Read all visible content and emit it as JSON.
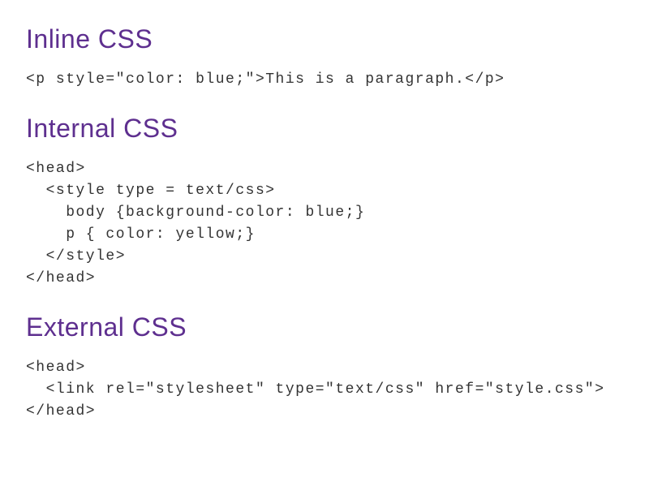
{
  "sections": [
    {
      "heading": "Inline CSS",
      "code": "<p style=\"color: blue;\">This is a paragraph.</p>"
    },
    {
      "heading": "Internal CSS",
      "code": "<head>\n  <style type = text/css>\n    body {background-color: blue;}\n    p { color: yellow;}\n  </style>\n</head>"
    },
    {
      "heading": "External CSS",
      "code": "<head>\n  <link rel=\"stylesheet\" type=\"text/css\" href=\"style.css\">\n</head>"
    }
  ]
}
